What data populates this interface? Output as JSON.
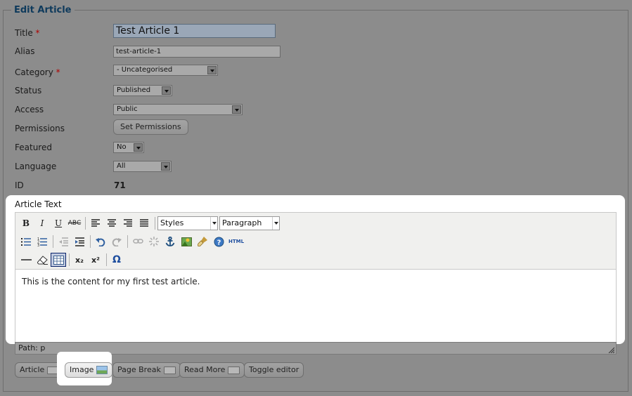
{
  "legend": "Edit Article",
  "form": {
    "title": {
      "label": "Title",
      "required": "*",
      "value": "Test Article 1"
    },
    "alias": {
      "label": "Alias",
      "value": "test-article-1"
    },
    "category": {
      "label": "Category",
      "required": "*",
      "value": "- Uncategorised"
    },
    "status": {
      "label": "Status",
      "value": "Published"
    },
    "access": {
      "label": "Access",
      "value": "Public"
    },
    "permissions": {
      "label": "Permissions",
      "button": "Set Permissions"
    },
    "featured": {
      "label": "Featured",
      "value": "No"
    },
    "language": {
      "label": "Language",
      "value": "All"
    },
    "id": {
      "label": "ID",
      "value": "71"
    }
  },
  "editor": {
    "label": "Article Text",
    "styles_select": "Styles",
    "format_select": "Paragraph",
    "content": "This is the content for my first test article.",
    "path": "Path: p",
    "toolbar_icons_row1": [
      "bold-icon",
      "italic-icon",
      "underline-icon",
      "strikethrough-icon",
      "align-left-icon",
      "align-center-icon",
      "align-right-icon",
      "align-justify-icon"
    ],
    "toolbar_icons_row2": [
      "bullet-list-icon",
      "numbered-list-icon",
      "outdent-icon",
      "indent-icon",
      "undo-icon",
      "redo-icon",
      "link-icon",
      "unlink-icon",
      "anchor-icon",
      "image-icon",
      "cleanup-icon",
      "help-icon",
      "html-icon"
    ],
    "toolbar_icons_row3": [
      "horizontal-rule-icon",
      "remove-format-icon",
      "visual-aid-icon",
      "subscript-icon",
      "superscript-icon",
      "special-char-icon"
    ]
  },
  "buttons": {
    "article": "Article",
    "image": "Image",
    "page_break": "Page Break",
    "read_more": "Read More",
    "toggle_editor": "Toggle editor"
  },
  "glyphs": {
    "bold": "B",
    "italic": "I",
    "underline": "U",
    "strike": "ABC",
    "subscript": "x₂",
    "superscript": "x²",
    "omega": "Ω",
    "html": "HTML",
    "help": "?"
  }
}
